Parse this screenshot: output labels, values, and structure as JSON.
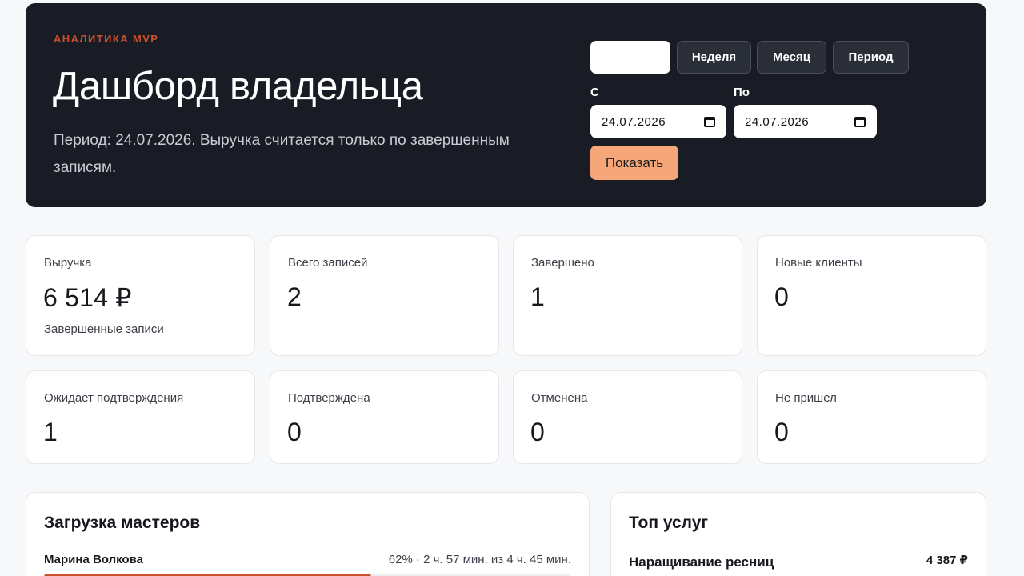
{
  "header": {
    "eyebrow": "АНАЛИТИКА MVP",
    "title": "Дашборд владельца",
    "description": "Период: 24.07.2026. Выручка считается только по завершенным записям."
  },
  "range": {
    "day_label": "",
    "week_label": "Неделя",
    "month_label": "Месяц",
    "period_label": "Период",
    "from_label": "С",
    "from_value": "24.07.2026",
    "to_label": "По",
    "to_value": "24.07.2026",
    "show_label": "Показать"
  },
  "stats": {
    "revenue": {
      "label": "Выручка",
      "value": "6 514 ₽",
      "sub": "Завершенные записи"
    },
    "total": {
      "label": "Всего записей",
      "value": "2"
    },
    "completed": {
      "label": "Завершено",
      "value": "1"
    },
    "new_clients": {
      "label": "Новые клиенты",
      "value": "0"
    },
    "pending": {
      "label": "Ожидает подтверждения",
      "value": "1"
    },
    "confirmed": {
      "label": "Подтверждена",
      "value": "0"
    },
    "cancelled": {
      "label": "Отменена",
      "value": "0"
    },
    "no_show": {
      "label": "Не пришел",
      "value": "0"
    }
  },
  "workload": {
    "title": "Загрузка мастеров",
    "masters": [
      {
        "name": "Марина Волкова",
        "meta": "62% · 2 ч. 57 мин. из 4 ч. 45 мин.",
        "percent": 62
      }
    ]
  },
  "top_services": {
    "title": "Топ услуг",
    "items": [
      {
        "name": "Наращивание ресниц",
        "value": "4 387 ₽"
      }
    ]
  },
  "colors": {
    "accent": "#c9502b",
    "show_button": "#f5a77a",
    "hero_bg": "#191c24"
  }
}
